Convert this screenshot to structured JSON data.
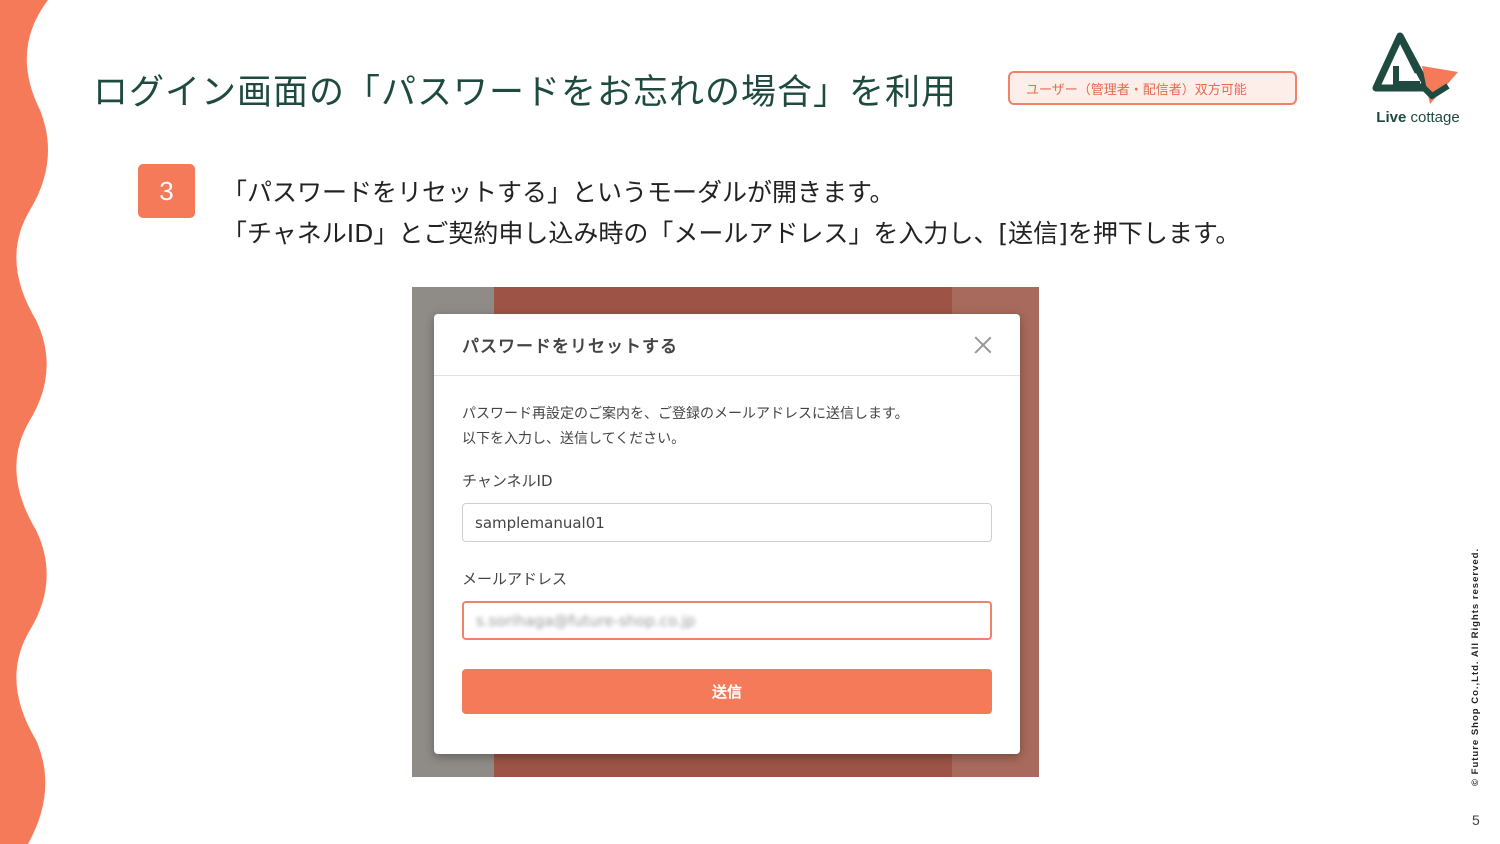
{
  "slide": {
    "title": "ログイン画面の「パスワードをお忘れの場合」を利用",
    "role_badge": "ユーザー（管理者・配信者）双方可能",
    "page_number": "5",
    "copyright": "© Future Shop Co.,Ltd. All Rights reserved."
  },
  "logo": {
    "brand_bold": "Live",
    "brand_light": " cottage"
  },
  "step": {
    "number": "3",
    "line1": "「パスワードをリセットする」というモーダルが開きます。",
    "line2": "「チャネルID」とご契約申し込み時の「メールアドレス」を入力し、[送信]を押下します。"
  },
  "modal": {
    "title": "パスワードをリセットする",
    "description_line1": "パスワード再設定のご案内を、ご登録のメールアドレスに送信します。",
    "description_line2": "以下を入力し、送信してください。",
    "channel_label": "チャンネルID",
    "channel_value": "samplemanual01",
    "email_label": "メールアドレス",
    "email_value": "s.sorihaga@future-shop.co.jp",
    "submit_label": "送信"
  },
  "colors": {
    "accent": "#f47a5a",
    "title_green": "#1f4a3f",
    "badge_border": "#f0826a"
  }
}
